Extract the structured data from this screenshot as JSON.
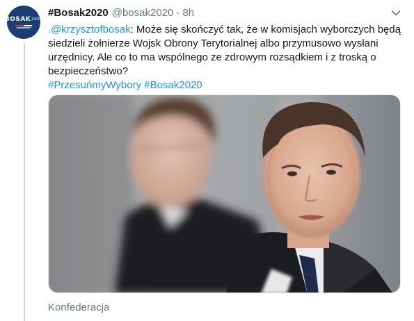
{
  "author": {
    "display_name": "#Bosak2020",
    "handle": "@bosak2020",
    "separator": "·",
    "time": "8h",
    "avatar_text": "BOSAK",
    "avatar_superscript": "2020",
    "avatar_color": "#1c3f73"
  },
  "tweet": {
    "mention": ".@krzysztofbosak",
    "body": ": Może się skończyć tak, że w komisjach wyborczych będą siedzieli żołnierze Wojsk Obrony Terytorialnej albo przymusowo wysłani urzędnicy. Ale co to ma wspólnego ze zdrowym rozsądkiem i z troską o bezpieczeństwo?",
    "hashtags": "#PrzesuńmyWybory #Bosak2020"
  },
  "media": {
    "kind": "photo"
  },
  "footer": {
    "source": "Konfederacja"
  },
  "colors": {
    "link": "#1b95e0",
    "secondary_text": "#657786",
    "thread_line": "#ccd6dd"
  },
  "icons": {
    "caret": "chevron-down-icon"
  }
}
